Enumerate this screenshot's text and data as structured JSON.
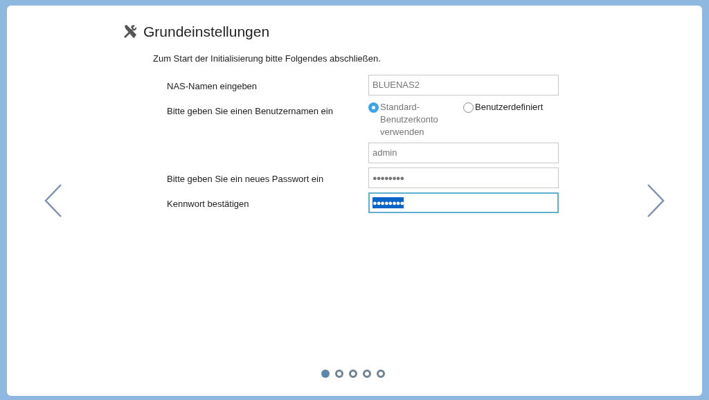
{
  "title": "Grundeinstellungen",
  "intro": "Zum Start der Initialisierung bitte Folgendes abschließen.",
  "rows": [
    {
      "kind": "text",
      "label": "NAS-Namen eingeben",
      "value": "BLUENAS2",
      "focused": false
    },
    {
      "kind": "radio",
      "label": "Bitte geben Sie einen Benutzernamen ein",
      "options": [
        {
          "label": "Standard-Benutzerkonto verwenden",
          "selected": true
        },
        {
          "label": "Benutzerdefiniert",
          "selected": false
        }
      ]
    },
    {
      "kind": "text",
      "value": "admin",
      "focused": false
    },
    {
      "kind": "password",
      "label": "Bitte geben Sie ein neues Passwort ein",
      "value": "●●●●●●●●",
      "focused": false
    },
    {
      "kind": "password",
      "label": "Kennwort bestätigen",
      "value": "●●●●●●●●",
      "focused": true
    }
  ],
  "pages": [
    {
      "selected": true
    },
    {
      "selected": false
    },
    {
      "selected": false
    },
    {
      "selected": false
    },
    {
      "selected": false
    }
  ]
}
